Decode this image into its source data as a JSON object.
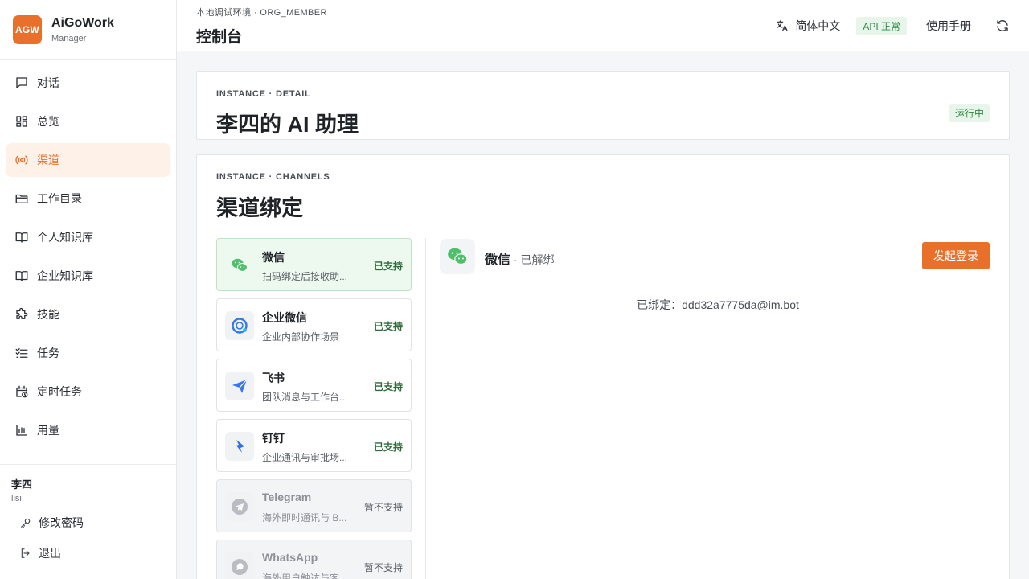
{
  "brand": {
    "logo_text": "AGW",
    "name": "AiGoWork",
    "role": "Manager",
    "accent": "#e8702a"
  },
  "nav": [
    {
      "label": "对话",
      "icon": "chat-icon",
      "active": false
    },
    {
      "label": "总览",
      "icon": "dashboard-icon",
      "active": false
    },
    {
      "label": "渠道",
      "icon": "broadcast-icon",
      "active": true
    },
    {
      "label": "工作目录",
      "icon": "folder-icon",
      "active": false
    },
    {
      "label": "个人知识库",
      "icon": "book-icon",
      "active": false
    },
    {
      "label": "企业知识库",
      "icon": "book-icon",
      "active": false
    },
    {
      "label": "技能",
      "icon": "puzzle-icon",
      "active": false
    },
    {
      "label": "任务",
      "icon": "tasklist-icon",
      "active": false
    },
    {
      "label": "定时任务",
      "icon": "calendar-clock-icon",
      "active": false
    },
    {
      "label": "用量",
      "icon": "bar-chart-icon",
      "active": false
    }
  ],
  "user": {
    "name": "李四",
    "login": "lisi",
    "change_password": "修改密码",
    "logout": "退出"
  },
  "header": {
    "breadcrumb": "本地调试环境 · ORG_MEMBER",
    "title": "控制台",
    "language": "简体中文",
    "api_status": "API 正常",
    "manual": "使用手册"
  },
  "instance": {
    "eyebrow": "INSTANCE · DETAIL",
    "title": "李四的 AI 助理",
    "status": "运行中"
  },
  "channels": {
    "eyebrow": "INSTANCE · CHANNELS",
    "title": "渠道绑定",
    "items": [
      {
        "name": "微信",
        "desc": "扫码绑定后接收助...",
        "status": "已支持",
        "icon": "wechat-icon",
        "selected": true,
        "disabled": false
      },
      {
        "name": "企业微信",
        "desc": "企业内部协作场景",
        "status": "已支持",
        "icon": "wecom-icon",
        "selected": false,
        "disabled": false
      },
      {
        "name": "飞书",
        "desc": "团队消息与工作台...",
        "status": "已支持",
        "icon": "feishu-icon",
        "selected": false,
        "disabled": false
      },
      {
        "name": "钉钉",
        "desc": "企业通讯与审批场...",
        "status": "已支持",
        "icon": "dingtalk-icon",
        "selected": false,
        "disabled": false
      },
      {
        "name": "Telegram",
        "desc": "海外即时通讯与 B...",
        "status": "暂不支持",
        "icon": "telegram-icon",
        "selected": false,
        "disabled": true
      },
      {
        "name": "WhatsApp",
        "desc": "海外用户触达与客...",
        "status": "暂不支持",
        "icon": "whatsapp-icon",
        "selected": false,
        "disabled": true
      }
    ]
  },
  "detail": {
    "name": "微信",
    "status": " · 已解绑",
    "login_button": "发起登录",
    "bound": "已绑定：ddd32a7775da@im.bot"
  }
}
